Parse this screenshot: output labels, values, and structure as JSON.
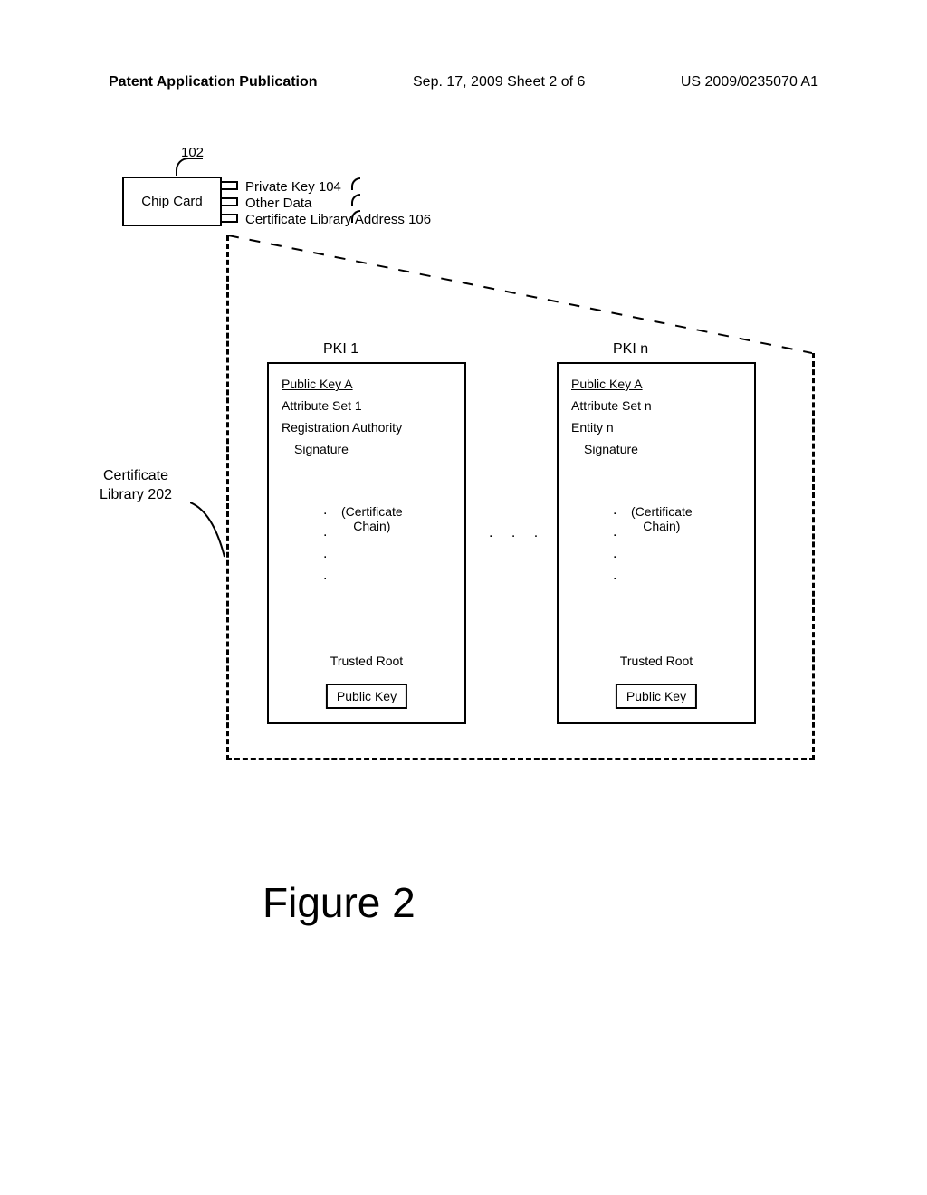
{
  "header": {
    "left": "Patent Application Publication",
    "center": "Sep. 17, 2009  Sheet 2 of 6",
    "right": "US 2009/0235070 A1"
  },
  "leader_102": "102",
  "chip_card": "Chip Card",
  "stub1": "Private Key  104",
  "stub2": "Other Data",
  "stub3": "Certificate Library Address  106",
  "cert_library_label": "Certificate\nLibrary 202",
  "pki1_title": "PKI 1",
  "pki1_pubkey": "Public Key A",
  "pki1_attr": "Attribute Set 1",
  "pki1_entity": "Registration Authority",
  "pki1_sig": "Signature",
  "pkin_title": "PKI n",
  "pkin_pubkey": "Public Key A",
  "pkin_attr": "Attribute Set n",
  "pkin_entity": "Entity n",
  "pkin_sig": "Signature",
  "cert_chain": "(Certificate\nChain)",
  "trusted_root": "Trusted Root",
  "public_key_box": "Public Key",
  "dots_h": ". . .",
  "figure": "Figure 2",
  "chart_data": {
    "type": "diagram",
    "title": "Figure 2",
    "description": "Chip card with private key referencing a certificate library containing multiple PKI chains",
    "nodes": [
      {
        "id": "chip_card",
        "label": "Chip Card",
        "ref": "102",
        "contains": [
          "Private Key 104",
          "Other Data",
          "Certificate Library Address 106"
        ]
      },
      {
        "id": "cert_library",
        "label": "Certificate Library 202",
        "contains": [
          "PKI 1",
          "PKI n"
        ]
      },
      {
        "id": "pki1",
        "label": "PKI 1",
        "cert": {
          "public_key": "Public Key A",
          "attributes": "Attribute Set 1",
          "signer": "Registration Authority",
          "sig": "Signature"
        },
        "chain_to": "Trusted Root (Public Key)"
      },
      {
        "id": "pkin",
        "label": "PKI n",
        "cert": {
          "public_key": "Public Key A",
          "attributes": "Attribute Set n",
          "signer": "Entity n",
          "sig": "Signature"
        },
        "chain_to": "Trusted Root (Public Key)"
      }
    ],
    "edges": [
      {
        "from": "chip_card",
        "to": "cert_library",
        "via": "Certificate Library Address 106"
      }
    ]
  }
}
